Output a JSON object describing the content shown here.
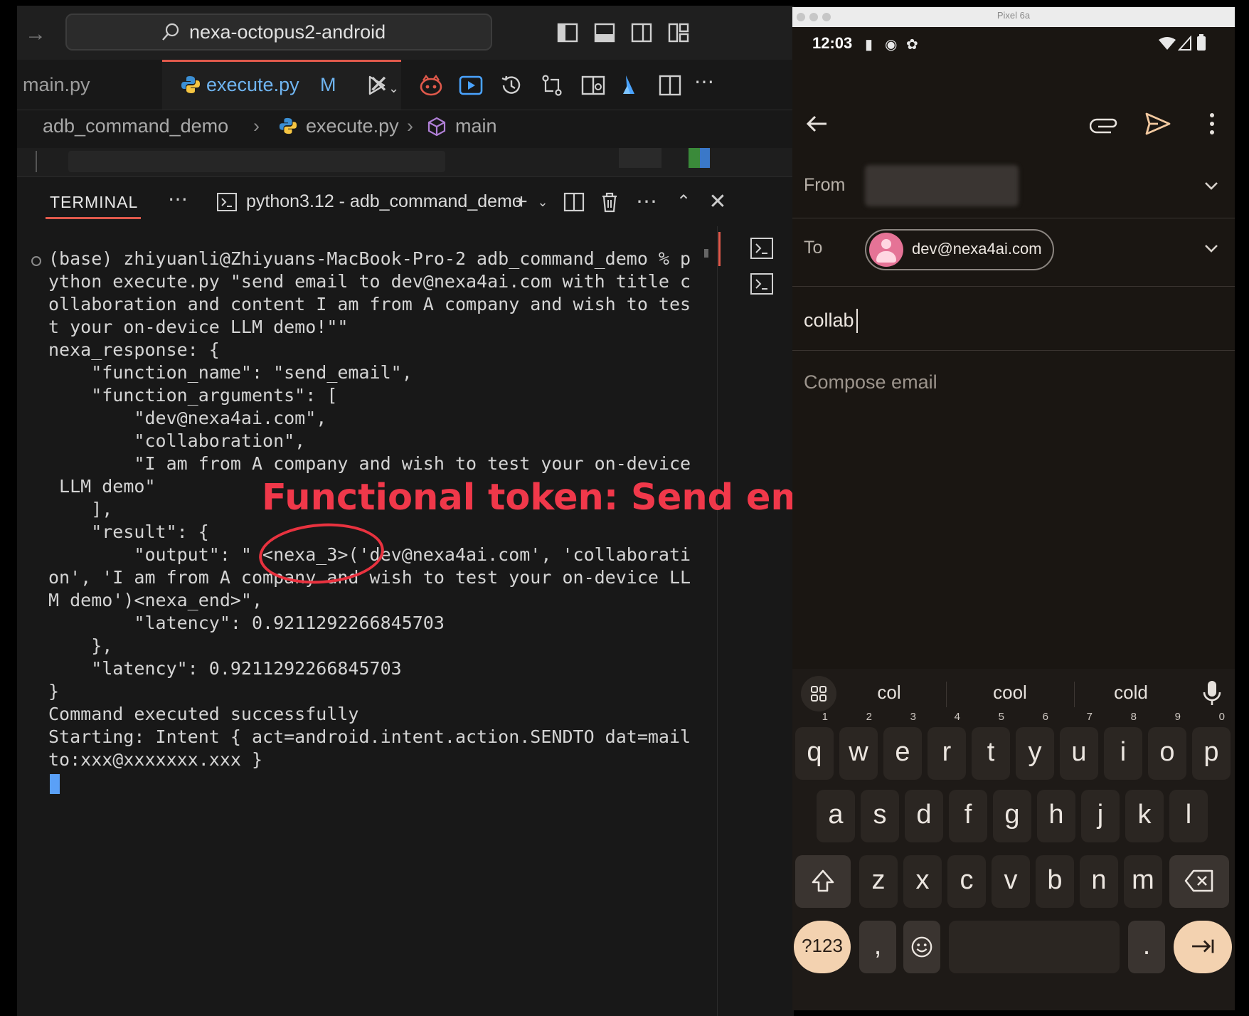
{
  "vscode": {
    "search_text": "nexa-octopus2-android",
    "tabs": [
      {
        "label": "main.py"
      },
      {
        "label": "execute.py",
        "status": "M"
      }
    ],
    "breadcrumb": [
      "adb_command_demo",
      "execute.py",
      "main"
    ],
    "panel": {
      "terminal_tab": "TERMINAL",
      "terminal_name": "python3.12 - adb_command_demo"
    },
    "terminal_output": "(base) zhiyuanli@Zhiyuans-MacBook-Pro-2 adb_command_demo % p\nython execute.py \"send email to dev@nexa4ai.com with title c\nollaboration and content I am from A company and wish to tes\nt your on-device LLM demo!\"\"\nnexa_response: {\n    \"function_name\": \"send_email\",\n    \"function_arguments\": [\n        \"dev@nexa4ai.com\",\n        \"collaboration\",\n        \"I am from A company and wish to test your on-device\n LLM demo\"\n    ],\n    \"result\": {\n        \"output\": \" <nexa_3>('dev@nexa4ai.com', 'collaborati\non', 'I am from A company and wish to test your on-device LL\nM demo')<nexa_end>\",\n        \"latency\": 0.9211292266845703\n    },\n    \"latency\": 0.9211292266845703\n}\nCommand executed successfully\nStarting: Intent { act=android.intent.action.SENDTO dat=mail\nto:xxx@xxxxxxx.xxx }",
    "annotation": "Functional token: Send email"
  },
  "emulator": {
    "window_title": "Pixel 6a",
    "status_time": "12:03",
    "compose": {
      "from_label": "From",
      "to_label": "To",
      "to_email": "dev@nexa4ai.com",
      "subject_value": "collab",
      "body_placeholder": "Compose email"
    },
    "keyboard": {
      "suggestions": [
        "col",
        "cool",
        "cold"
      ],
      "row1": [
        "q",
        "w",
        "e",
        "r",
        "t",
        "y",
        "u",
        "i",
        "o",
        "p"
      ],
      "row1_hints": [
        "1",
        "2",
        "3",
        "4",
        "5",
        "6",
        "7",
        "8",
        "9",
        "0"
      ],
      "row2": [
        "a",
        "s",
        "d",
        "f",
        "g",
        "h",
        "j",
        "k",
        "l"
      ],
      "row3": [
        "z",
        "x",
        "c",
        "v",
        "b",
        "n",
        "m"
      ],
      "symbols_key": "?123",
      "comma_key": ",",
      "period_key": "."
    }
  },
  "colors": {
    "annotation_red": "#f0384a",
    "accent_blue": "#6fb4f0",
    "keyboard_accent": "#f3d2b0"
  }
}
